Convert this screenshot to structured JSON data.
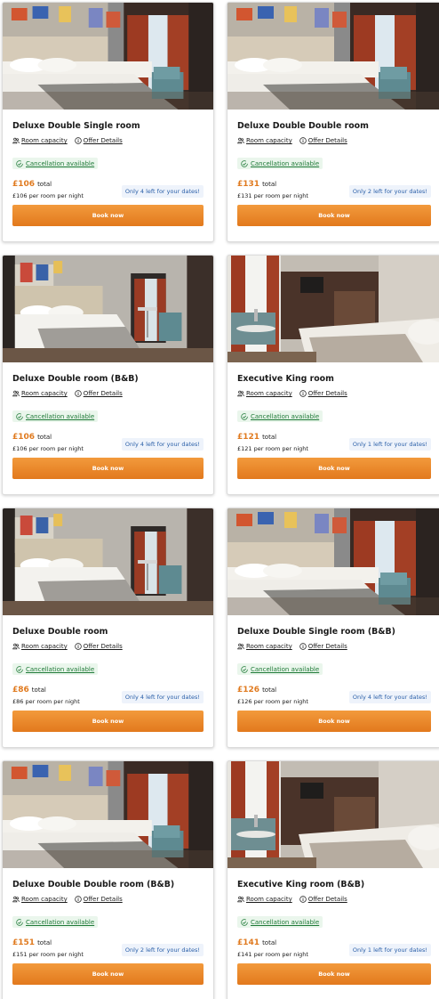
{
  "rooms": [
    {
      "title": "Deluxe Double Single room",
      "capacity_label": "Room capacity",
      "offer_label": "Offer Details",
      "cancellation": "Cancellation available",
      "price": "£106",
      "total_label": "total",
      "per_night": "£106 per room per night",
      "availability": "Only 4 left for your dates!",
      "book_label": "Book now",
      "photo": "twin"
    },
    {
      "title": "Deluxe Double Double room",
      "capacity_label": "Room capacity",
      "offer_label": "Offer Details",
      "cancellation": "Cancellation available",
      "price": "£131",
      "total_label": "total",
      "per_night": "£131 per room per night",
      "availability": "Only 2 left for your dates!",
      "book_label": "Book now",
      "photo": "twin"
    },
    {
      "title": "Deluxe Double room (B&B)",
      "capacity_label": "Room capacity",
      "offer_label": "Offer Details",
      "cancellation": "Cancellation available",
      "price": "£106",
      "total_label": "total",
      "per_night": "£106 per room per night",
      "availability": "Only 4 left for your dates!",
      "book_label": "Book now",
      "photo": "double"
    },
    {
      "title": "Executive King room",
      "capacity_label": "Room capacity",
      "offer_label": "Offer Details",
      "cancellation": "Cancellation available",
      "price": "£121",
      "total_label": "total",
      "per_night": "£121 per room per night",
      "availability": "Only 1 left for your dates!",
      "book_label": "Book now",
      "photo": "king"
    },
    {
      "title": "Deluxe Double room",
      "capacity_label": "Room capacity",
      "offer_label": "Offer Details",
      "cancellation": "Cancellation available",
      "price": "£86",
      "total_label": "total",
      "per_night": "£86 per room per night",
      "availability": "Only 4 left for your dates!",
      "book_label": "Book now",
      "photo": "double"
    },
    {
      "title": "Deluxe Double Single room (B&B)",
      "capacity_label": "Room capacity",
      "offer_label": "Offer Details",
      "cancellation": "Cancellation available",
      "price": "£126",
      "total_label": "total",
      "per_night": "£126 per room per night",
      "availability": "Only 4 left for your dates!",
      "book_label": "Book now",
      "photo": "twin"
    },
    {
      "title": "Deluxe Double Double room (B&B)",
      "capacity_label": "Room capacity",
      "offer_label": "Offer Details",
      "cancellation": "Cancellation available",
      "price": "£151",
      "total_label": "total",
      "per_night": "£151 per room per night",
      "availability": "Only 2 left for your dates!",
      "book_label": "Book now",
      "photo": "twin"
    },
    {
      "title": "Executive King room (B&B)",
      "capacity_label": "Room capacity",
      "offer_label": "Offer Details",
      "cancellation": "Cancellation available",
      "price": "£141",
      "total_label": "total",
      "per_night": "£141 per room per night",
      "availability": "Only 1 left for your dates!",
      "book_label": "Book now",
      "photo": "king"
    }
  ],
  "colors": {
    "price": "#e07a1f",
    "book_button": "#e9852a",
    "cancellation_text": "#1f7a38",
    "availability_text": "#2a5fa8"
  }
}
